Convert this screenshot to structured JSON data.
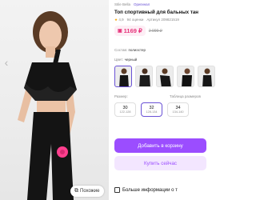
{
  "product": {
    "brand": "Stile Bella",
    "original": "Оригинал",
    "title": "Топ спортивный для бальных тан",
    "rating": "4,9",
    "reviews": "94 оценки",
    "article": "Артикул 209821519"
  },
  "price": {
    "current": "1169 ₽",
    "old": "2 999 ₽"
  },
  "seller": {
    "label": "Состав:",
    "value": "полиэстер"
  },
  "color": {
    "label": "Цвет:",
    "value": "черный",
    "swatches": [
      "photo-1",
      "photo-2",
      "photo-3",
      "photo-4",
      "photo-5"
    ]
  },
  "size": {
    "label": "Размер:",
    "table_link": "Таблица размеров",
    "options": [
      {
        "size": "30",
        "height": "122-128"
      },
      {
        "size": "32",
        "height": "128-134"
      },
      {
        "size": "34",
        "height": "134-140"
      }
    ],
    "selected_index": 1
  },
  "actions": {
    "add_to_cart": "Добавить в корзину",
    "buy_now": "Купить сейчас",
    "more_info": "Больше информации о т",
    "similar": "Похожие"
  },
  "colors": {
    "accent": "#9b4dff",
    "price": "#e6337a",
    "selected_border": "#6a52d6"
  }
}
